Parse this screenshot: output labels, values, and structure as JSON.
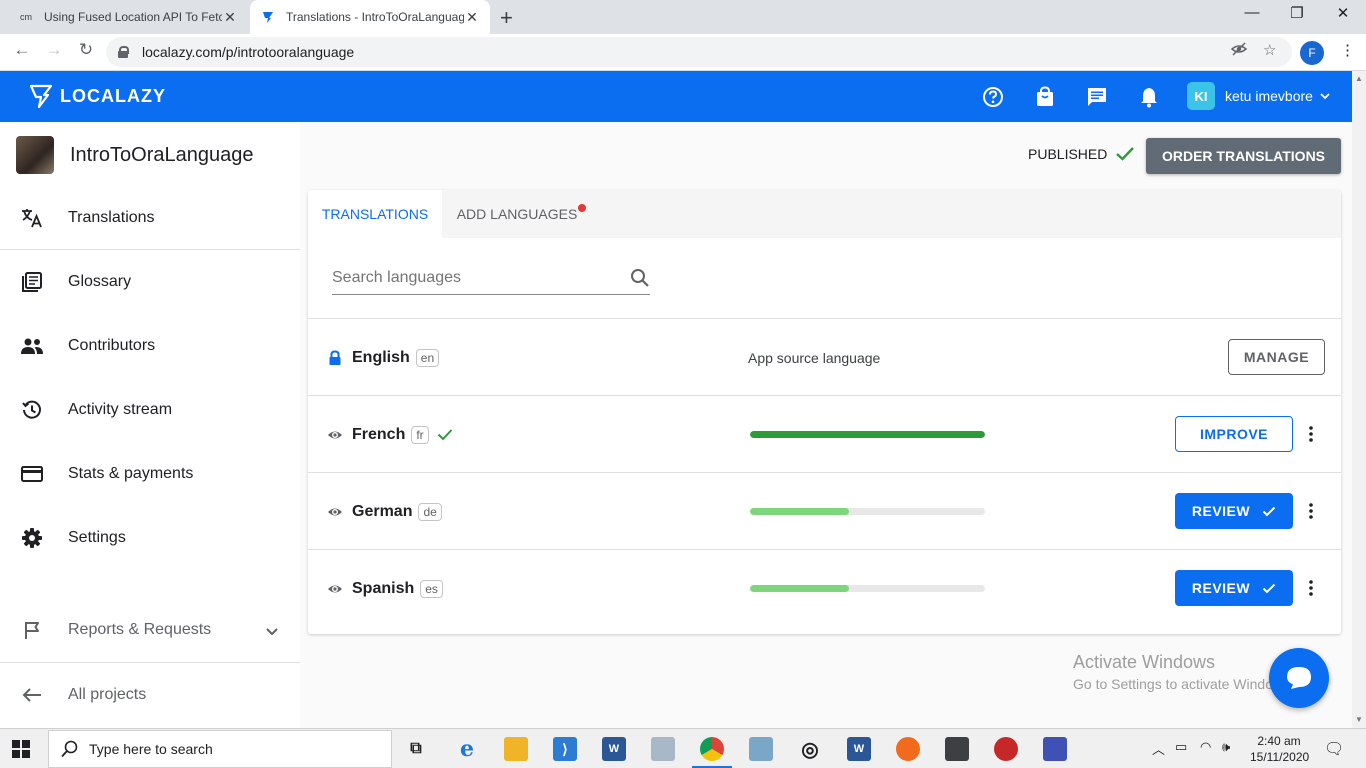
{
  "browser": {
    "tabs": [
      {
        "title": "Using Fused Location API To Fetc",
        "favicon": "cm",
        "active": false
      },
      {
        "title": "Translations - IntroToOraLanguag",
        "active": true
      }
    ],
    "new_tab_label": "+",
    "url": "localazy.com/p/introtooralanguage",
    "profile_initial": "F"
  },
  "app": {
    "brand": "LOCALAZY",
    "accent_color": "#0b6ef0",
    "user_initials": "KI",
    "user_name": "ketu imevbore"
  },
  "sidebar": {
    "project_name": "IntroToOraLanguage",
    "items": [
      {
        "label": "Translations",
        "icon": "translate-icon"
      },
      {
        "label": "Glossary",
        "icon": "book-icon"
      },
      {
        "label": "Contributors",
        "icon": "people-icon"
      },
      {
        "label": "Activity stream",
        "icon": "history-icon"
      },
      {
        "label": "Stats & payments",
        "icon": "credit-card-icon"
      },
      {
        "label": "Settings",
        "icon": "gear-icon"
      },
      {
        "label": "Reports & Requests",
        "icon": "flag-icon"
      },
      {
        "label": "All projects",
        "icon": "arrow-left-icon"
      }
    ]
  },
  "header": {
    "status": "PUBLISHED",
    "order_button": "ORDER TRANSLATIONS"
  },
  "card": {
    "tabs": [
      {
        "label": "TRANSLATIONS",
        "active": true
      },
      {
        "label": "ADD LANGUAGES",
        "active": false,
        "has_badge": true
      }
    ],
    "search_placeholder": "Search languages",
    "languages": [
      {
        "name": "English",
        "code": "en",
        "icon": "lock-icon",
        "source_label": "App source language",
        "button": "MANAGE"
      },
      {
        "name": "French",
        "code": "fr",
        "icon": "eye-icon",
        "complete": true,
        "progress": 1.0,
        "button": "IMPROVE"
      },
      {
        "name": "German",
        "code": "de",
        "icon": "eye-icon",
        "progress": 0.42,
        "button": "REVIEW"
      },
      {
        "name": "Spanish",
        "code": "es",
        "icon": "eye-icon",
        "progress": 0.42,
        "button": "REVIEW"
      }
    ]
  },
  "watermark": {
    "line1": "Activate Windows",
    "line2": "Go to Settings to activate Windows."
  },
  "taskbar": {
    "search_placeholder": "Type here to search",
    "time": "2:40 am",
    "date": "15/11/2020"
  }
}
